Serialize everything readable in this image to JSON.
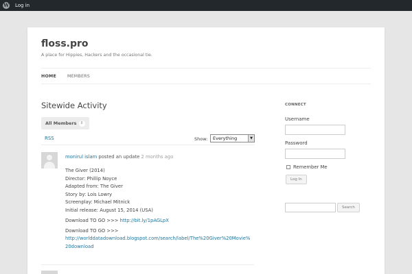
{
  "admin_bar": {
    "login_label": "Log in"
  },
  "site": {
    "title": "floss.pro",
    "description": "A place for Hippies, Hackers and the occasional tie."
  },
  "nav": {
    "items": [
      {
        "label": "HOME"
      },
      {
        "label": "MEMBERS"
      }
    ]
  },
  "main": {
    "heading": "Sitewide Activity",
    "tab": {
      "label": "All Members",
      "count": "8"
    },
    "rss_label": "RSS",
    "filter": {
      "label": "Show:",
      "value": "Everything"
    },
    "activity": {
      "author": "monirul islam",
      "action": "posted an update",
      "time_ago": "2 months ago",
      "lines": [
        "The Giver (2014)",
        "Director: Phillip Noyce",
        "Adapted from: The Giver",
        "Story by: Lois Lowry",
        "Screenplay: Michael Mitnick",
        "Initial release: August 15, 2014 (USA)"
      ],
      "download1_prefix": "Download TO GO >>> ",
      "download1_link": "http://bit.ly/1pAGLpX",
      "download2_prefix": "Download TO GO >>> ",
      "download2_link": "http://worlddatadownload.blogspot.com/search/label/The%20Giver%20Movie%20download"
    }
  },
  "sidebar": {
    "connect_title": "CONNECT",
    "username_label": "Username",
    "password_label": "Password",
    "remember_label": "Remember Me",
    "login_button": "Log In",
    "search_button": "Search"
  }
}
